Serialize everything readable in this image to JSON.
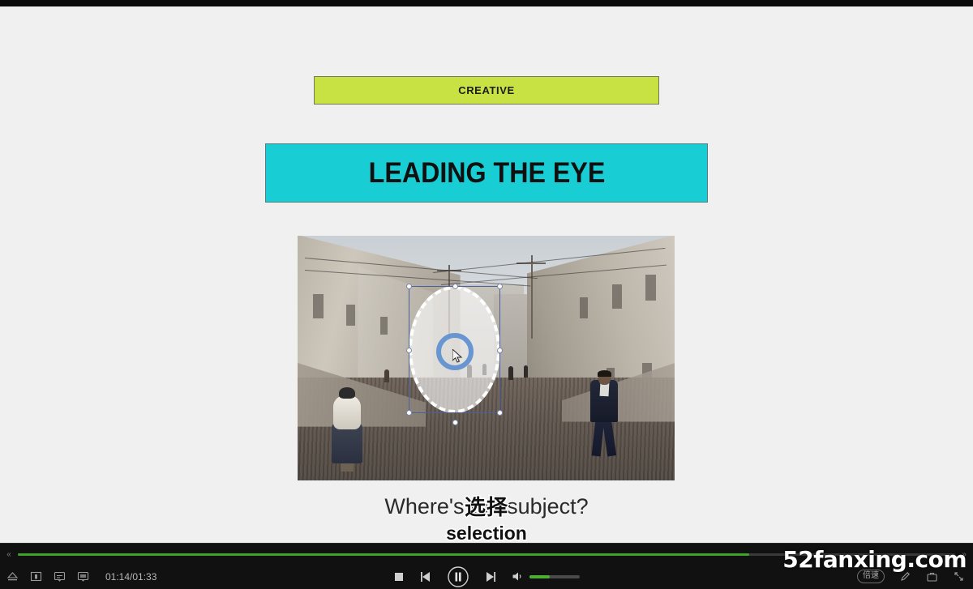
{
  "slide": {
    "creative_banner": {
      "label": "CREATIVE"
    },
    "title_banner": {
      "label": "LEADING THE EYE"
    },
    "subtitle": {
      "text": "Where's the subject?",
      "overlay_cn": "选择",
      "overlay_en": "selection"
    },
    "photo": {
      "alt": "colonial street scene with woman in shawl at left and man in dark suit at right",
      "selection_tool": "ellipse-selection"
    },
    "colors": {
      "creative_bg": "#c9e243",
      "title_bg": "#18cdd4",
      "slide_bg": "#f0f0f0",
      "selection_box": "#4a5f9e",
      "cursor_ring": "#5d8fd0"
    }
  },
  "player": {
    "time": "01:14/01:33",
    "progress_percent": 78,
    "volume_percent": 40,
    "rewind_arrow": "«",
    "forward_arrow": "»",
    "speed_badge": "倍速",
    "icons": {
      "eject": "eject-icon",
      "snapshot": "snapshot-icon",
      "screen_a": "screen-a-icon",
      "screen_b": "screen-b-icon",
      "stop": "stop-icon",
      "previous": "previous-icon",
      "pause": "pause-icon",
      "next": "next-icon",
      "volume": "volume-icon",
      "pen": "pen-icon",
      "capture": "capture-icon",
      "fullscreen": "fullscreen-icon"
    },
    "watermark": "52fanxing.com"
  }
}
